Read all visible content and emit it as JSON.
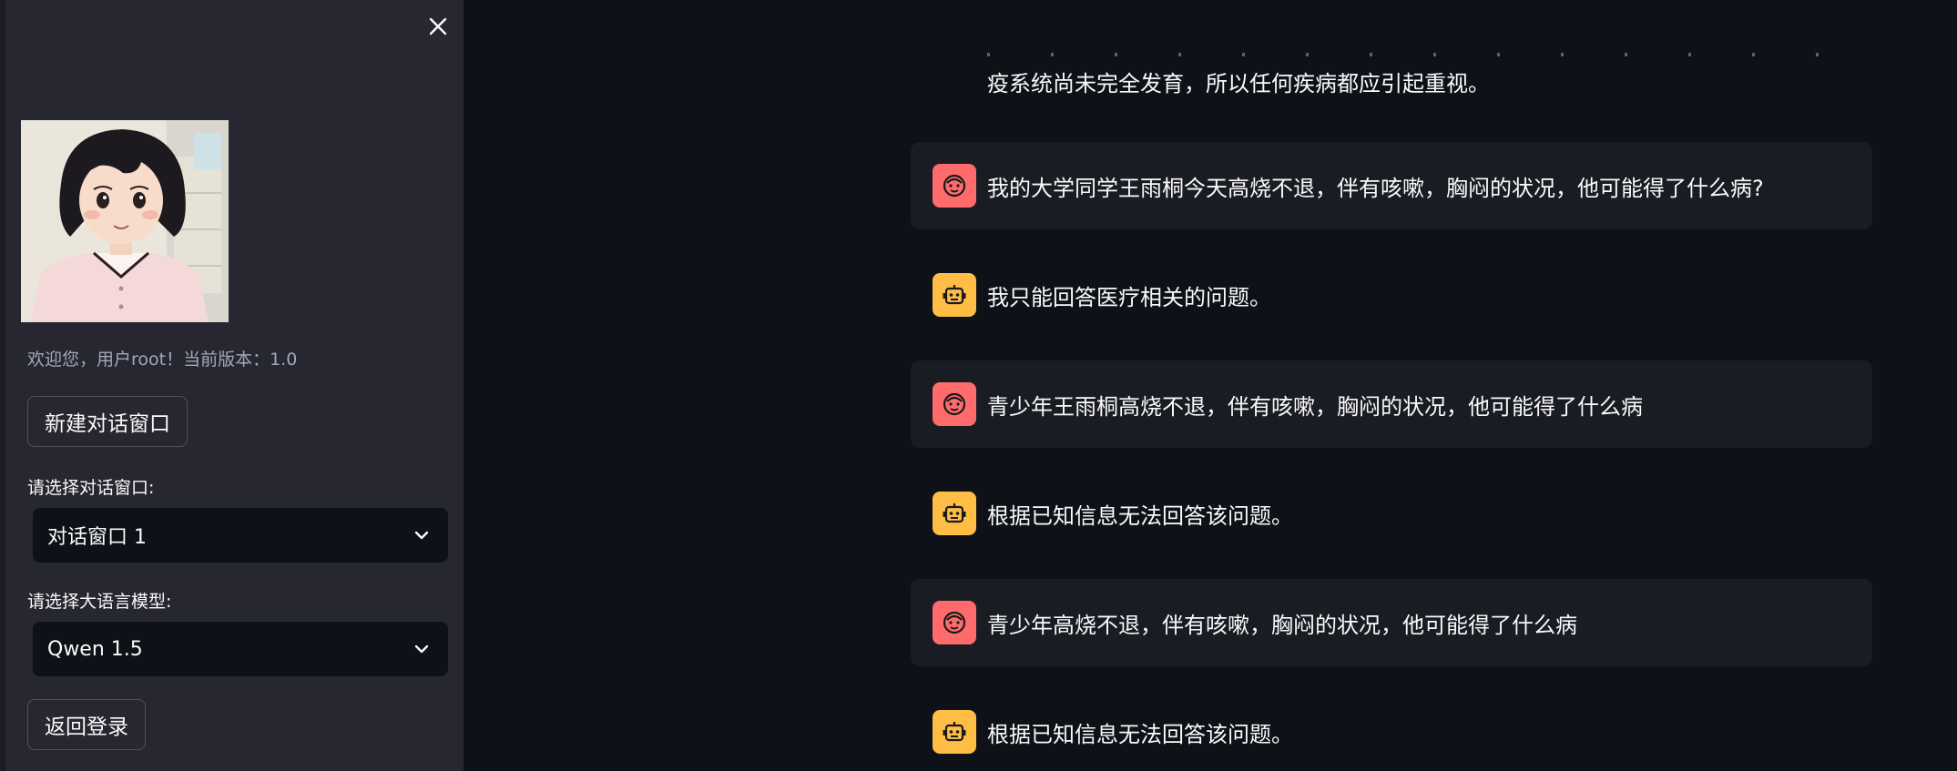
{
  "sidebar": {
    "close_icon": "close-icon",
    "welcome_text": "欢迎您，用户root！当前版本：1.0",
    "new_chat_button": "新建对话窗口",
    "window_select_label": "请选择对话窗口:",
    "window_select_value": "对话窗口 1",
    "model_select_label": "请选择大语言模型:",
    "model_select_value": "Qwen 1.5",
    "back_login_button": "返回登录"
  },
  "chat": {
    "partial_text": "疫系统尚未完全发育，所以任何疾病都应引起重视。",
    "messages": [
      {
        "role": "user",
        "text": "我的大学同学王雨桐今天高烧不退，伴有咳嗽，胸闷的状况，他可能得了什么病?"
      },
      {
        "role": "assistant",
        "text": "我只能回答医疗相关的问题。"
      },
      {
        "role": "user",
        "text": "青少年王雨桐高烧不退，伴有咳嗽，胸闷的状况，他可能得了什么病"
      },
      {
        "role": "assistant",
        "text": "根据已知信息无法回答该问题。"
      },
      {
        "role": "user",
        "text": "青少年高烧不退，伴有咳嗽，胸闷的状况，他可能得了什么病"
      },
      {
        "role": "assistant",
        "text": "根据已知信息无法回答该问题。"
      }
    ]
  },
  "colors": {
    "background": "#0e1117",
    "sidebar": "#262730",
    "user_avatar": "#ff6b6b",
    "assistant_avatar": "#ffbd45",
    "user_message_bg": "#1a1c24"
  }
}
